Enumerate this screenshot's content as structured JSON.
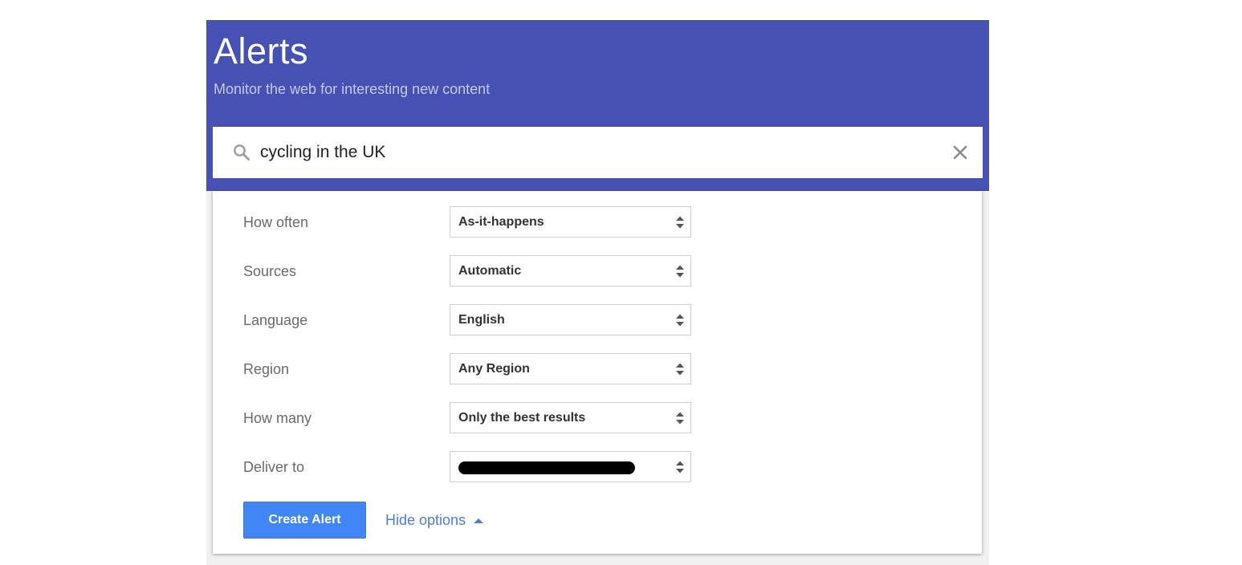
{
  "header": {
    "title": "Alerts",
    "subtitle": "Monitor the web for interesting new content"
  },
  "search": {
    "value": "cycling in the UK",
    "search_icon": "search-icon",
    "clear_icon": "close-icon"
  },
  "options": [
    {
      "label": "How often",
      "value": "As-it-happens"
    },
    {
      "label": "Sources",
      "value": "Automatic"
    },
    {
      "label": "Language",
      "value": "English"
    },
    {
      "label": "Region",
      "value": "Any Region"
    },
    {
      "label": "How many",
      "value": "Only the best results"
    },
    {
      "label": "Deliver to",
      "value": ""
    }
  ],
  "actions": {
    "create_label": "Create Alert",
    "hide_options_label": "Hide options",
    "hide_options_icon": "triangle-up-icon"
  },
  "colors": {
    "header_bg": "#4751b3",
    "button_bg": "#4285f4",
    "link": "#4a7ed8"
  }
}
